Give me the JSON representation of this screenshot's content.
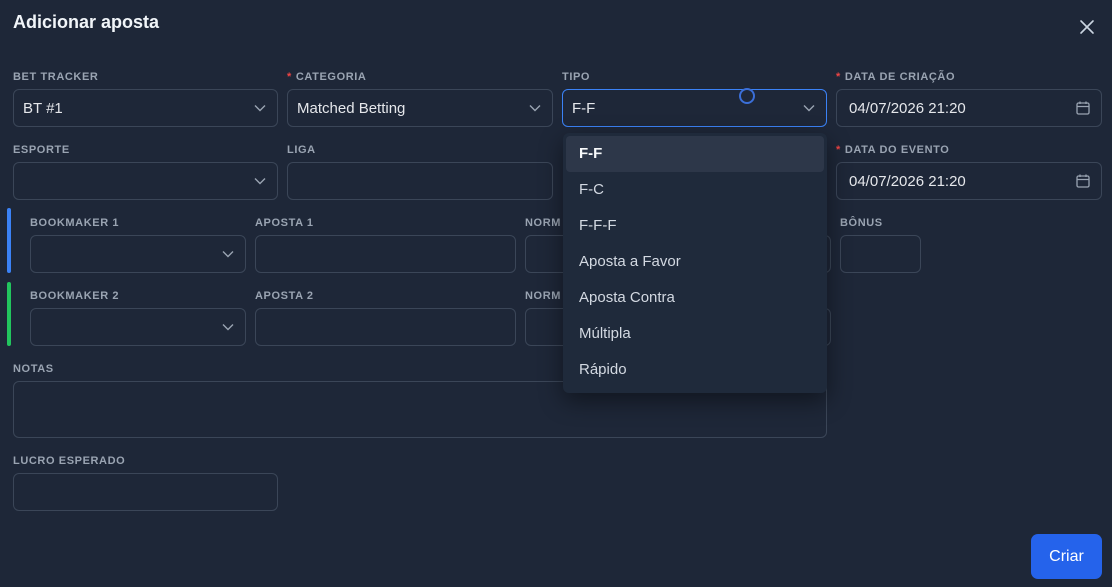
{
  "dialog": {
    "title": "Adicionar aposta",
    "close_icon": "close-icon"
  },
  "form": {
    "bet_tracker": {
      "label": "BET TRACKER",
      "value": "BT #1"
    },
    "categoria": {
      "label": "CATEGORIA",
      "required_mark": "*",
      "value": "Matched Betting"
    },
    "tipo": {
      "label": "TIPO",
      "value": "F-F"
    },
    "data_criacao": {
      "label": "DATA DE CRIAÇÃO",
      "required_mark": "*",
      "value": "04/07/2026 21:20"
    },
    "esporte": {
      "label": "ESPORTE",
      "value": ""
    },
    "liga": {
      "label": "LIGA",
      "value": ""
    },
    "data_evento": {
      "label": "DATA DO EVENTO",
      "required_mark": "*",
      "value": "04/07/2026 21:20"
    },
    "row1": {
      "accent": "#3b82f6",
      "bookmaker_label": "BOOKMAKER 1",
      "aposta_label": "APOSTA 1",
      "norm_label": "NORM",
      "bonus_label": "BÔNUS"
    },
    "row2": {
      "accent": "#22c55e",
      "bookmaker_label": "BOOKMAKER 2",
      "aposta_label": "APOSTA 2",
      "norm_label": "NORM"
    },
    "notas": {
      "label": "NOTAS",
      "value": ""
    },
    "lucro": {
      "label": "LUCRO ESPERADO",
      "value": ""
    }
  },
  "tipo_dropdown": {
    "options": [
      "F-F",
      "F-C",
      "F-F-F",
      "Aposta a Favor",
      "Aposta Contra",
      "Múltipla",
      "Rápido"
    ],
    "selected": "F-F"
  },
  "actions": {
    "create_label": "Criar"
  },
  "colors": {
    "background": "#1e2738",
    "accent": "#2563eb",
    "focus": "#3b82f6",
    "required": "#ef4444"
  }
}
